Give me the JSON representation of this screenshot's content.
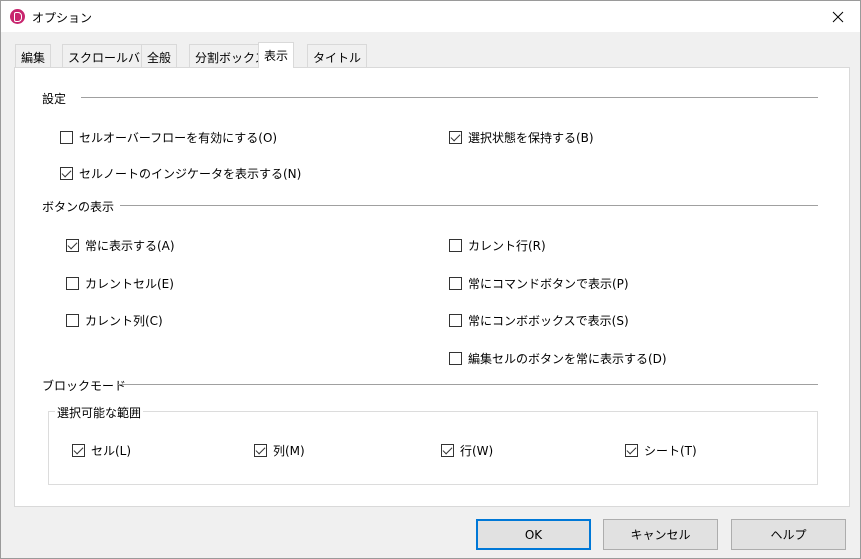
{
  "window": {
    "title": "オプション"
  },
  "tabs": [
    {
      "label": "編集"
    },
    {
      "label": "スクロールバー"
    },
    {
      "label": "全般"
    },
    {
      "label": "分割ボックス"
    },
    {
      "label": "表示",
      "active": true
    },
    {
      "label": "タイトル"
    }
  ],
  "settings": {
    "heading": "設定",
    "cell_overflow": {
      "label": "セルオーバーフローを有効にする(O)",
      "checked": false
    },
    "keep_selection": {
      "label": "選択状態を保持する(B)",
      "checked": true
    },
    "note_indicator": {
      "label": "セルノートのインジケータを表示する(N)",
      "checked": true
    }
  },
  "button_display": {
    "heading": "ボタンの表示",
    "always_show": {
      "label": "常に表示する(A)",
      "checked": true
    },
    "current_cell": {
      "label": "カレントセル(E)",
      "checked": false
    },
    "current_column": {
      "label": "カレント列(C)",
      "checked": false
    },
    "current_row": {
      "label": "カレント行(R)",
      "checked": false
    },
    "always_command_button": {
      "label": "常にコマンドボタンで表示(P)",
      "checked": false
    },
    "always_combo_box": {
      "label": "常にコンボボックスで表示(S)",
      "checked": false
    },
    "always_edit_cell_button": {
      "label": "編集セルのボタンを常に表示する(D)",
      "checked": false
    }
  },
  "block_mode": {
    "heading": "ブロックモード",
    "range_label": "選択可能な範囲",
    "cell": {
      "label": "セル(L)",
      "checked": true
    },
    "column": {
      "label": "列(M)",
      "checked": true
    },
    "row": {
      "label": "行(W)",
      "checked": true
    },
    "sheet": {
      "label": "シート(T)",
      "checked": true
    }
  },
  "buttons": {
    "ok": "OK",
    "cancel": "キャンセル",
    "help": "ヘルプ"
  },
  "colors": {
    "accent": "#0078d7",
    "app_icon": "#c8256e"
  }
}
